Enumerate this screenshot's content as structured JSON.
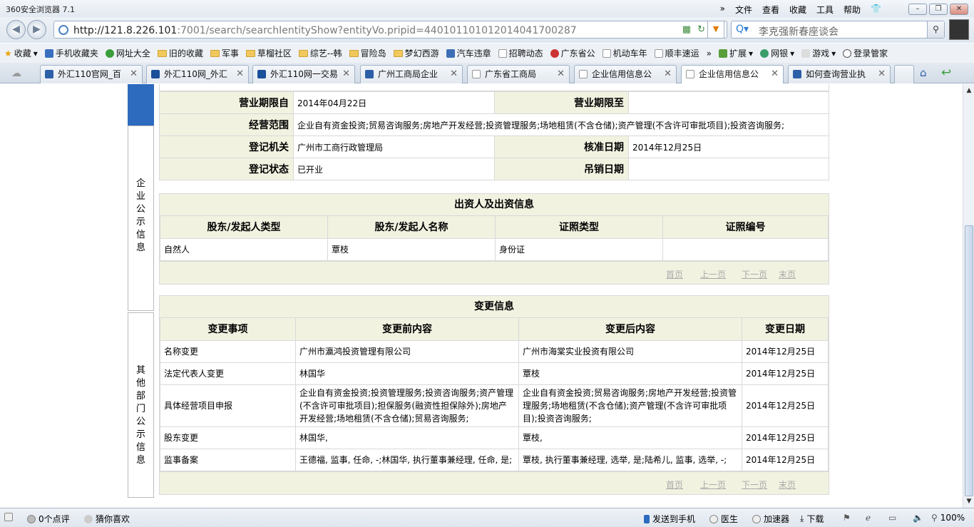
{
  "browser": {
    "title": "360安全浏览器 7.1",
    "menus": [
      "»",
      "文件",
      "查看",
      "收藏",
      "工具",
      "帮助"
    ],
    "url_host": "http://121.8.226.101",
    "url_rest": ":7001/search/searchIentityShow?entityVo.pripid=440101101012014041700287",
    "search_text": "李克强新春座谈会",
    "favorites": [
      "收藏",
      "手机收藏夹",
      "网址大全",
      "旧的收藏",
      "军事",
      "草榴社区",
      "综艺--韩",
      "冒险岛",
      "梦幻西游",
      "汽车违章",
      "招聘动态",
      "广东省公",
      "机动车年",
      "顺丰速运",
      "»",
      "扩展",
      "网银",
      "游戏",
      "登录管家"
    ],
    "tabs": [
      "外汇110官网_百",
      "外汇110网_外汇",
      "外汇110网一交易",
      "广州工商局企业",
      "广东省工商局",
      "企业信用信息公",
      "企业信用信息公",
      "如何查询营业执"
    ]
  },
  "sidebar": {
    "section1": "企业公示信息",
    "section2": "其他部门公示信息"
  },
  "basic_info": {
    "period_from_label": "营业期限自",
    "period_from": "2014年04月22日",
    "period_to_label": "营业期限至",
    "period_to": "",
    "scope_label": "经营范围",
    "scope": "企业自有资金投资;贸易咨询服务;房地产开发经营;投资管理服务;场地租赁(不含仓储);资产管理(不含许可审批项目);投资咨询服务;",
    "authority_label": "登记机关",
    "authority": "广州市工商行政管理局",
    "approve_label": "核准日期",
    "approve": "2014年12月25日",
    "status_label": "登记状态",
    "status": "已开业",
    "revoke_label": "吊销日期",
    "revoke": ""
  },
  "investors": {
    "title": "出资人及出资信息",
    "headers": [
      "股东/发起人类型",
      "股东/发起人名称",
      "证照类型",
      "证照编号"
    ],
    "rows": [
      [
        "自然人",
        "覃枝",
        "身份证",
        ""
      ]
    ]
  },
  "pager": {
    "first": "首页",
    "prev": "上一页",
    "next": "下一页",
    "last": "末页"
  },
  "changes": {
    "title": "变更信息",
    "headers": [
      "变更事项",
      "变更前内容",
      "变更后内容",
      "变更日期"
    ],
    "rows": [
      [
        "名称变更",
        "广州市瀛鸿投资管理有限公司",
        "广州市海棠实业投资有限公司",
        "2014年12月25日"
      ],
      [
        "法定代表人变更",
        "林国华",
        "覃枝",
        "2014年12月25日"
      ],
      [
        "具体经营项目申报",
        "企业自有资金投资;投资管理服务;投资咨询服务;资产管理(不含许可审批项目);担保服务(融资性担保除外);房地产开发经营;场地租赁(不含仓储);贸易咨询服务;",
        "企业自有资金投资;贸易咨询服务;房地产开发经营;投资管理服务;场地租赁(不含仓储);资产管理(不含许可审批项目);投资咨询服务;",
        "2014年12月25日"
      ],
      [
        "股东变更",
        "林国华,",
        "覃枝,",
        "2014年12月25日"
      ],
      [
        "监事备案",
        "王德福, 监事, 任命, -;林国华, 执行董事兼经理, 任命, 是;",
        "覃枝, 执行董事兼经理, 选举, 是;陆希儿, 监事, 选举, -;",
        "2014年12月25日"
      ]
    ]
  },
  "status": {
    "comments": "0个点评",
    "guess": "猜你喜欢",
    "send_phone": "发送到手机",
    "doctor": "医生",
    "accelerator": "加速器",
    "download": "下载",
    "zoom": "100%"
  }
}
